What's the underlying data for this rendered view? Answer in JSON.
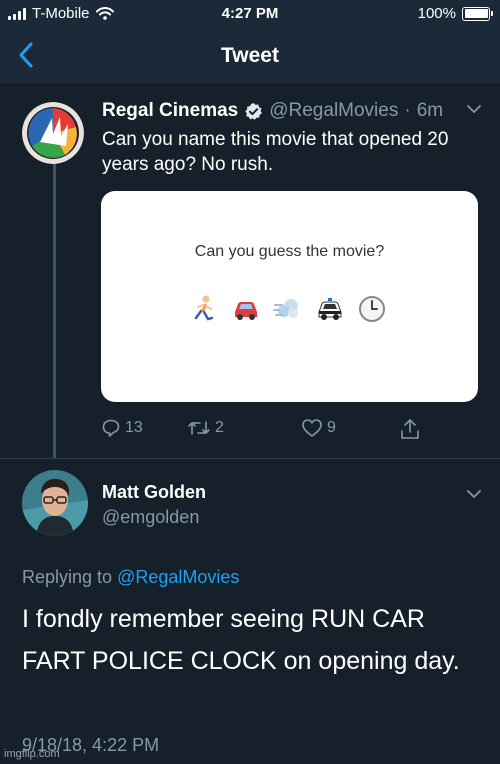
{
  "status_bar": {
    "carrier": "T-Mobile",
    "time": "4:27 PM",
    "battery": "100%"
  },
  "nav": {
    "title": "Tweet"
  },
  "tweet": {
    "display_name": "Regal Cinemas",
    "handle": "@RegalMovies",
    "separator": "·",
    "time_ago": "6m",
    "text": "Can you name this movie that opened 20 years ago? No rush.",
    "media": {
      "caption": "Can you guess the movie?",
      "emojis": [
        "runner-emoji",
        "car-emoji",
        "dash-emoji",
        "police-car-emoji",
        "clock-emoji"
      ]
    },
    "actions": {
      "replies": "13",
      "retweets": "2",
      "likes": "9"
    }
  },
  "reply": {
    "display_name": "Matt Golden",
    "handle": "@emgolden",
    "replying_prefix": "Replying to",
    "replying_to": "@RegalMovies",
    "text": "I fondly remember seeing RUN CAR FART POLICE CLOCK on opening day.",
    "timestamp": "9/18/18, 4:22 PM"
  },
  "watermark": "imgflip.com",
  "colors": {
    "background": "#15202b",
    "accent": "#1da1f2",
    "secondary_text": "#8899a6"
  }
}
